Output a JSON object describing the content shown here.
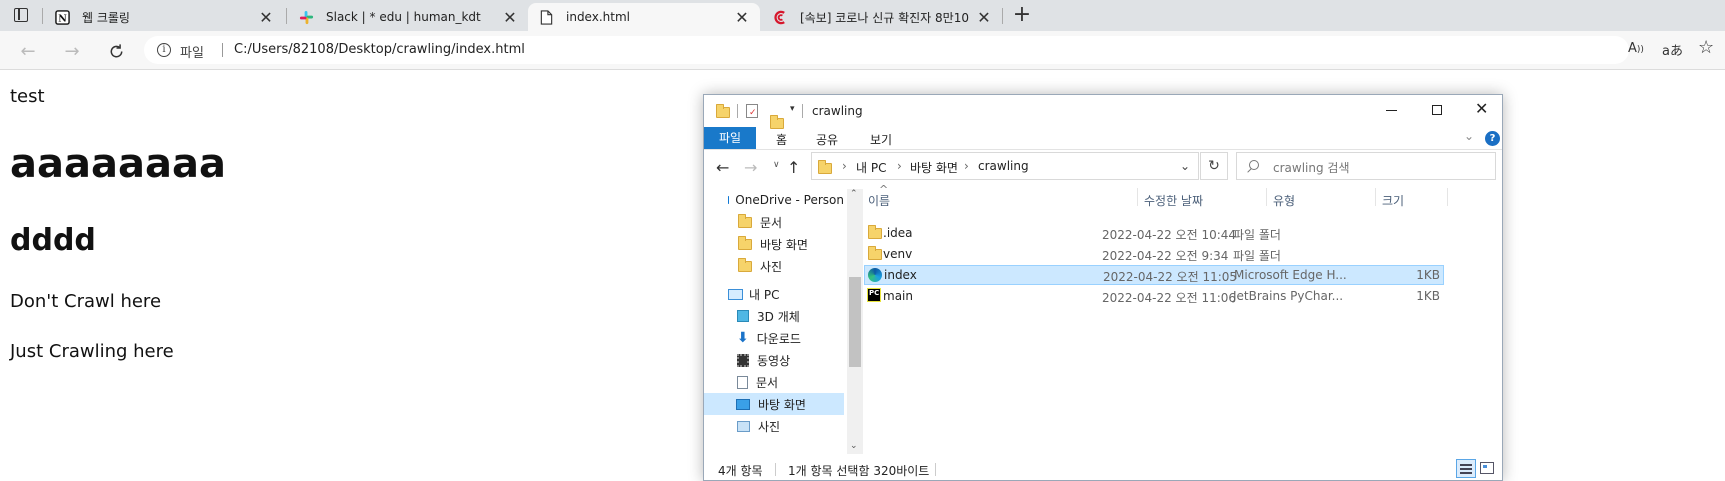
{
  "browser": {
    "tabs": [
      {
        "title": "웹 크롤링",
        "icon": "notion-icon"
      },
      {
        "title": "Slack | * edu | human_kdt",
        "icon": "slack-icon"
      },
      {
        "title": "index.html",
        "icon": "document-icon"
      },
      {
        "title": "[속보] 코로나 신규 확진자 8만10",
        "icon": "news-icon"
      }
    ],
    "address": {
      "security_label": "파일",
      "url": "C:/Users/82108/Desktop/crawling/index.html"
    }
  },
  "page": {
    "p1": "test",
    "h1": "aaaaaaaa",
    "h2": "dddd",
    "p2": "Don't Crawl here",
    "p3": "Just Crawling here"
  },
  "explorer": {
    "title": "crawling",
    "ribbon_tabs": [
      "파일",
      "홈",
      "공유",
      "보기"
    ],
    "breadcrumb": [
      "내 PC",
      "바탕 화면",
      "crawling"
    ],
    "search_placeholder": "crawling 검색",
    "columns": {
      "name": "이름",
      "modified": "수정한 날짜",
      "type": "유형",
      "size": "크기"
    },
    "files": [
      {
        "name": ".idea",
        "modified": "2022-04-22 오전 10:44",
        "type": "파일 폴더",
        "size": ""
      },
      {
        "name": "venv",
        "modified": "2022-04-22 오전 9:34",
        "type": "파일 폴더",
        "size": ""
      },
      {
        "name": "index",
        "modified": "2022-04-22 오전 11:05",
        "type": "Microsoft Edge H...",
        "size": "1KB"
      },
      {
        "name": "main",
        "modified": "2022-04-22 오전 11:06",
        "type": "JetBrains PyChar...",
        "size": "1KB"
      }
    ],
    "nav": [
      {
        "label": "OneDrive - Person"
      },
      {
        "label": "문서"
      },
      {
        "label": "바탕 화면"
      },
      {
        "label": "사진"
      },
      {
        "label": "내 PC"
      },
      {
        "label": "3D 개체"
      },
      {
        "label": "다운로드"
      },
      {
        "label": "동영상"
      },
      {
        "label": "문서"
      },
      {
        "label": "바탕 화면"
      },
      {
        "label": "사진"
      }
    ],
    "status": {
      "count": "4개 항목",
      "selection": "1개 항목 선택함 320바이트"
    }
  }
}
